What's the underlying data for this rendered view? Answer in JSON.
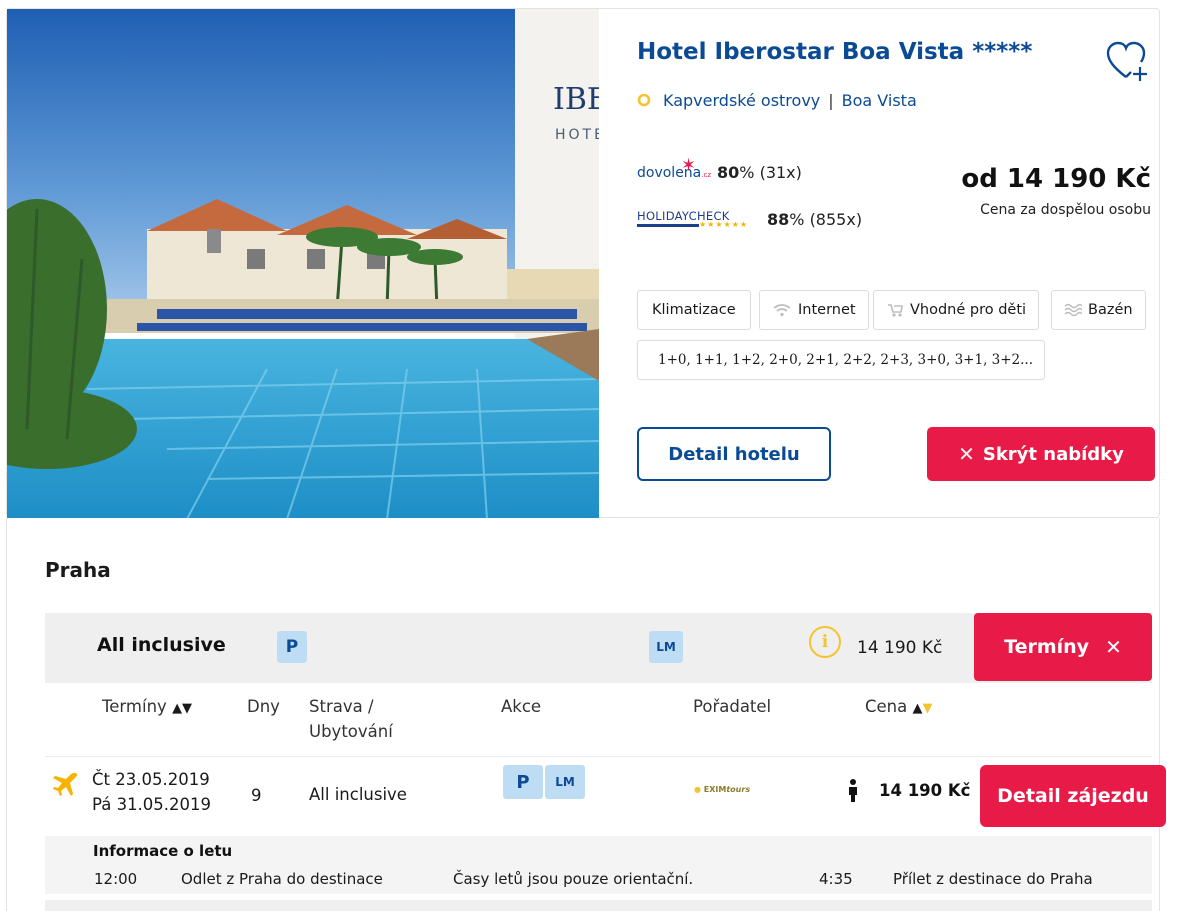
{
  "hotel": {
    "name": "Hotel Iberostar Boa Vista *****",
    "country": "Kapverdské ostrovy",
    "separator": "|",
    "region": "Boa Vista",
    "photo_sign_line1": "IBE",
    "photo_sign_line2": "HOTE",
    "ratings": {
      "dovolena": {
        "logo": "dovolena",
        "logo_suffix": ".cz",
        "percent": "80",
        "percent_sign": "%",
        "count": "(31x)"
      },
      "holidaycheck": {
        "logo": "HOLIDAYCHECK",
        "logo_stars": "★★★★★★",
        "percent": "88",
        "percent_sign": "%",
        "count": "(855x)"
      }
    },
    "price": {
      "from": "od  14 190 Kč",
      "note": "Cena za dospělou osobu"
    },
    "amenities": [
      "Klimatizace",
      "Internet",
      "Vhodné pro děti",
      "Bazén"
    ],
    "room_types": "1+0, 1+1, 1+2, 2+0, 2+1, 2+2, 2+3, 3+0, 3+1, 3+2...",
    "buttons": {
      "detail": "Detail hotelu",
      "hide_x": "✕",
      "hide": "Skrýt nabídky"
    }
  },
  "offers": {
    "city": "Praha",
    "board_bar": {
      "board": "All inclusive",
      "badge_p": "P",
      "badge_lm": "LM",
      "info_icon": "i",
      "price": "14 190 Kč",
      "terms_button": "Termíny",
      "terms_x": "✕"
    },
    "columns": {
      "terms": "Termíny",
      "terms_arrows": "▲▼",
      "days": "Dny",
      "board_line1": "Strava /",
      "board_line2": "Ubytování",
      "promo": "Akce",
      "organizer": "Pořadatel",
      "price": "Cena",
      "price_arrow_up": "▲",
      "price_arrow_down": "▼"
    },
    "rows": [
      {
        "date_from": "Čt 23.05.2019",
        "date_to": "Pá 31.05.2019",
        "days": "9",
        "board": "All inclusive",
        "badges": [
          "P",
          "LM"
        ],
        "organizer": "EXIM",
        "organizer_suffix": "tours",
        "price": "14 190 Kč",
        "button": "Detail zájezdu",
        "flight": {
          "title": "Informace o letu",
          "departure_time": "12:00",
          "departure_text": "Odlet z Praha do destinace",
          "note": "Časy letů jsou pouze orientační.",
          "arrival_time": "4:35",
          "arrival_text": "Přílet z destinace do Praha"
        }
      }
    ]
  },
  "colors": {
    "brand_blue": "#0b4a94",
    "accent_red": "#e81a47",
    "badge_blue": "#bfdcf5",
    "info_yellow": "#f4c430"
  },
  "icons": [
    "location-pin-icon",
    "heart-plus-icon",
    "wifi-icon",
    "stroller-icon",
    "pool-waves-icon",
    "bed-icon",
    "close-icon",
    "info-icon",
    "plane-icon",
    "person-icon"
  ]
}
